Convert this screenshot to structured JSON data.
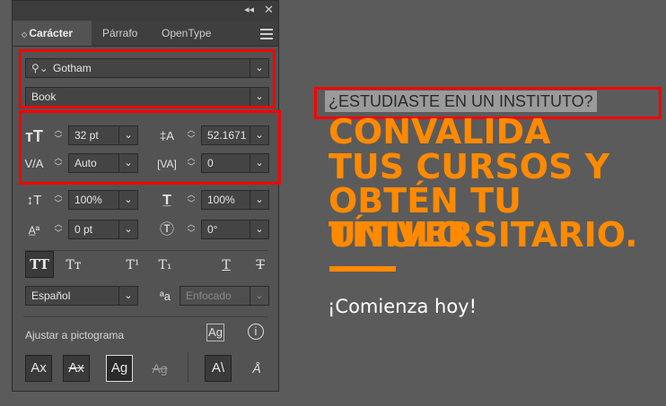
{
  "panel": {
    "collapse_icon": "double-chevron-icon",
    "close_icon": "close-icon",
    "tabs": [
      {
        "label": "Carácter"
      },
      {
        "label": "Párrafo"
      },
      {
        "label": "OpenType"
      }
    ],
    "font_family": "Gotham",
    "font_style": "Book",
    "font_size": "32 pt",
    "leading": "52.1671",
    "kerning": "Auto",
    "tracking": "0",
    "vertical_scale": "100%",
    "horizontal_scale": "100%",
    "baseline_shift": "0 pt",
    "rotation": "0°",
    "language": "Español",
    "antialias": "Enfocado",
    "snap_label": "Ajustar a pictograma",
    "accent_color": "#ff0000"
  },
  "artwork": {
    "question": "¿ESTUDIASTE EN UN INSTITUTO?",
    "headline": [
      "CONVALIDA",
      "TUS CURSOS Y",
      "OBTÉN TU TÍTULO",
      "UNIVERSITARIO."
    ],
    "cta": "¡Comienza hoy!",
    "orange": "#ff8a00"
  }
}
